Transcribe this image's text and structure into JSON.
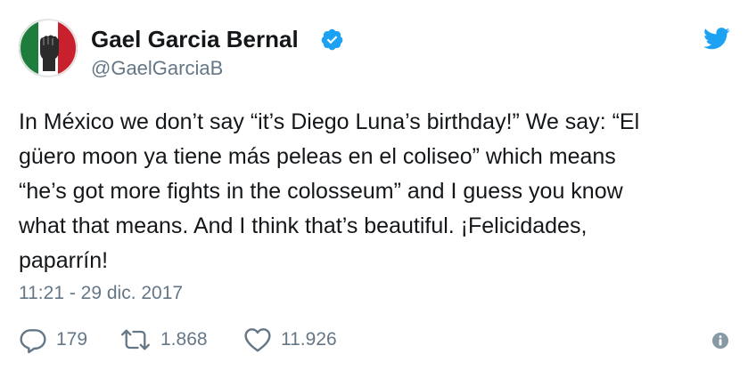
{
  "user": {
    "display_name": "Gael Garcia Bernal",
    "handle": "@GaelGarciaB",
    "verified": true,
    "avatar_icon": "raised-fist-mexican-flag-avatar",
    "verified_icon": "verified-badge-icon",
    "avatar_colors": {
      "green": "#1e7c3c",
      "white": "#ffffff",
      "red": "#c8202d"
    }
  },
  "brand": {
    "icon": "twitter-bird-icon",
    "color": "#1da1f2"
  },
  "tweet": {
    "lines": [
      "In México we don’t say “it’s Diego Luna’s birthday!” We say: “El",
      "güero moon ya tiene más peleas en el coliseo” which means",
      "“he’s got more fights in the colosseum” and I guess you know",
      "what that means. And I think that’s beautiful. ¡Felicidades,",
      "paparrín!"
    ],
    "timestamp": "11:21 - 29 dic. 2017"
  },
  "actions": {
    "reply": {
      "icon": "reply-icon",
      "count": "179"
    },
    "retweet": {
      "icon": "retweet-icon",
      "count": "1.868"
    },
    "like": {
      "icon": "heart-icon",
      "count": "11.926"
    },
    "info": {
      "icon": "info-icon"
    }
  },
  "colors": {
    "text": "#14171a",
    "secondary": "#657786",
    "accent": "#1da1f2"
  }
}
